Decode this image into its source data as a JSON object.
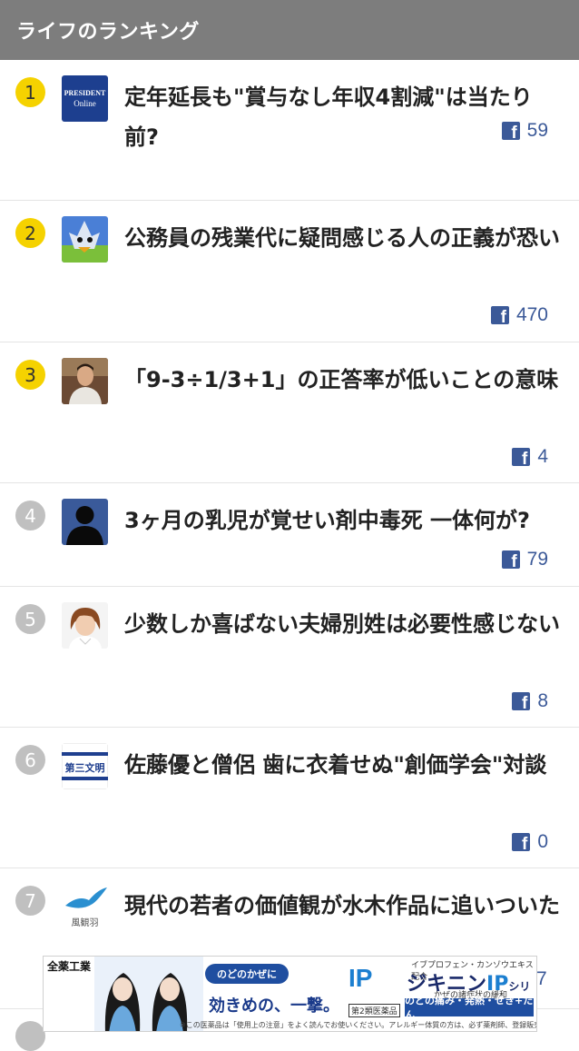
{
  "header": {
    "title": "ライフのランキング"
  },
  "items": [
    {
      "rank": "1",
      "title": "定年延長も\"賞与なし年収4割減\"は当たり前?",
      "fb_count": "59",
      "thumb": "president-online-logo",
      "thumb_text": [
        "PRESIDENT",
        "Online"
      ]
    },
    {
      "rank": "2",
      "title": "公務員の残業代に疑問感じる人の正義が恐い",
      "fb_count": "470",
      "thumb": "cartoon-avatar"
    },
    {
      "rank": "3",
      "title": "「9-3÷1/3+1」の正答率が低いことの意味",
      "fb_count": "4",
      "thumb": "author-photo"
    },
    {
      "rank": "4",
      "title": "3ヶ月の乳児が覚せい剤中毒死 一体何が?",
      "fb_count": "79",
      "thumb": "default-silhouette"
    },
    {
      "rank": "5",
      "title": "少数しか喜ばない夫婦別姓は必要性感じない",
      "fb_count": "8",
      "thumb": "author-photo-woman"
    },
    {
      "rank": "6",
      "title": "佐藤優と僧侶 歯に衣着せぬ\"創価学会\"対談",
      "fb_count": "0",
      "thumb": "daisan-bunmei-logo",
      "thumb_text": [
        "第三文明"
      ]
    },
    {
      "rank": "7",
      "title": "現代の若者の価値観が水木作品に追いついた",
      "fb_count": "7",
      "thumb": "fukanwa-logo",
      "thumb_text": [
        "風観羽"
      ]
    }
  ],
  "ad": {
    "brand": "全薬工業",
    "bubble": "のどのかぜに",
    "copy": "効きめの、一撃。",
    "product_tagline": "イブプロフェン・カンゾウエキス配合",
    "product_name": "ジキニン",
    "product_suffix": "IP",
    "series": "シリーズ",
    "sub": "かぜの諸症状の緩和",
    "band": "のどの痛み・発熱・せき+たん",
    "classification": "第2類医薬品",
    "note": "※この医薬品は「使用上の注意」をよく読んでお使いください。アレルギー体質の方は、必ず薬剤師、登録販売者にご相談ください。"
  },
  "colors": {
    "header_bg": "#7d7d7d",
    "rank_top": "#f5d200",
    "rank_rest": "#c0c0c0",
    "facebook": "#3b5998"
  }
}
